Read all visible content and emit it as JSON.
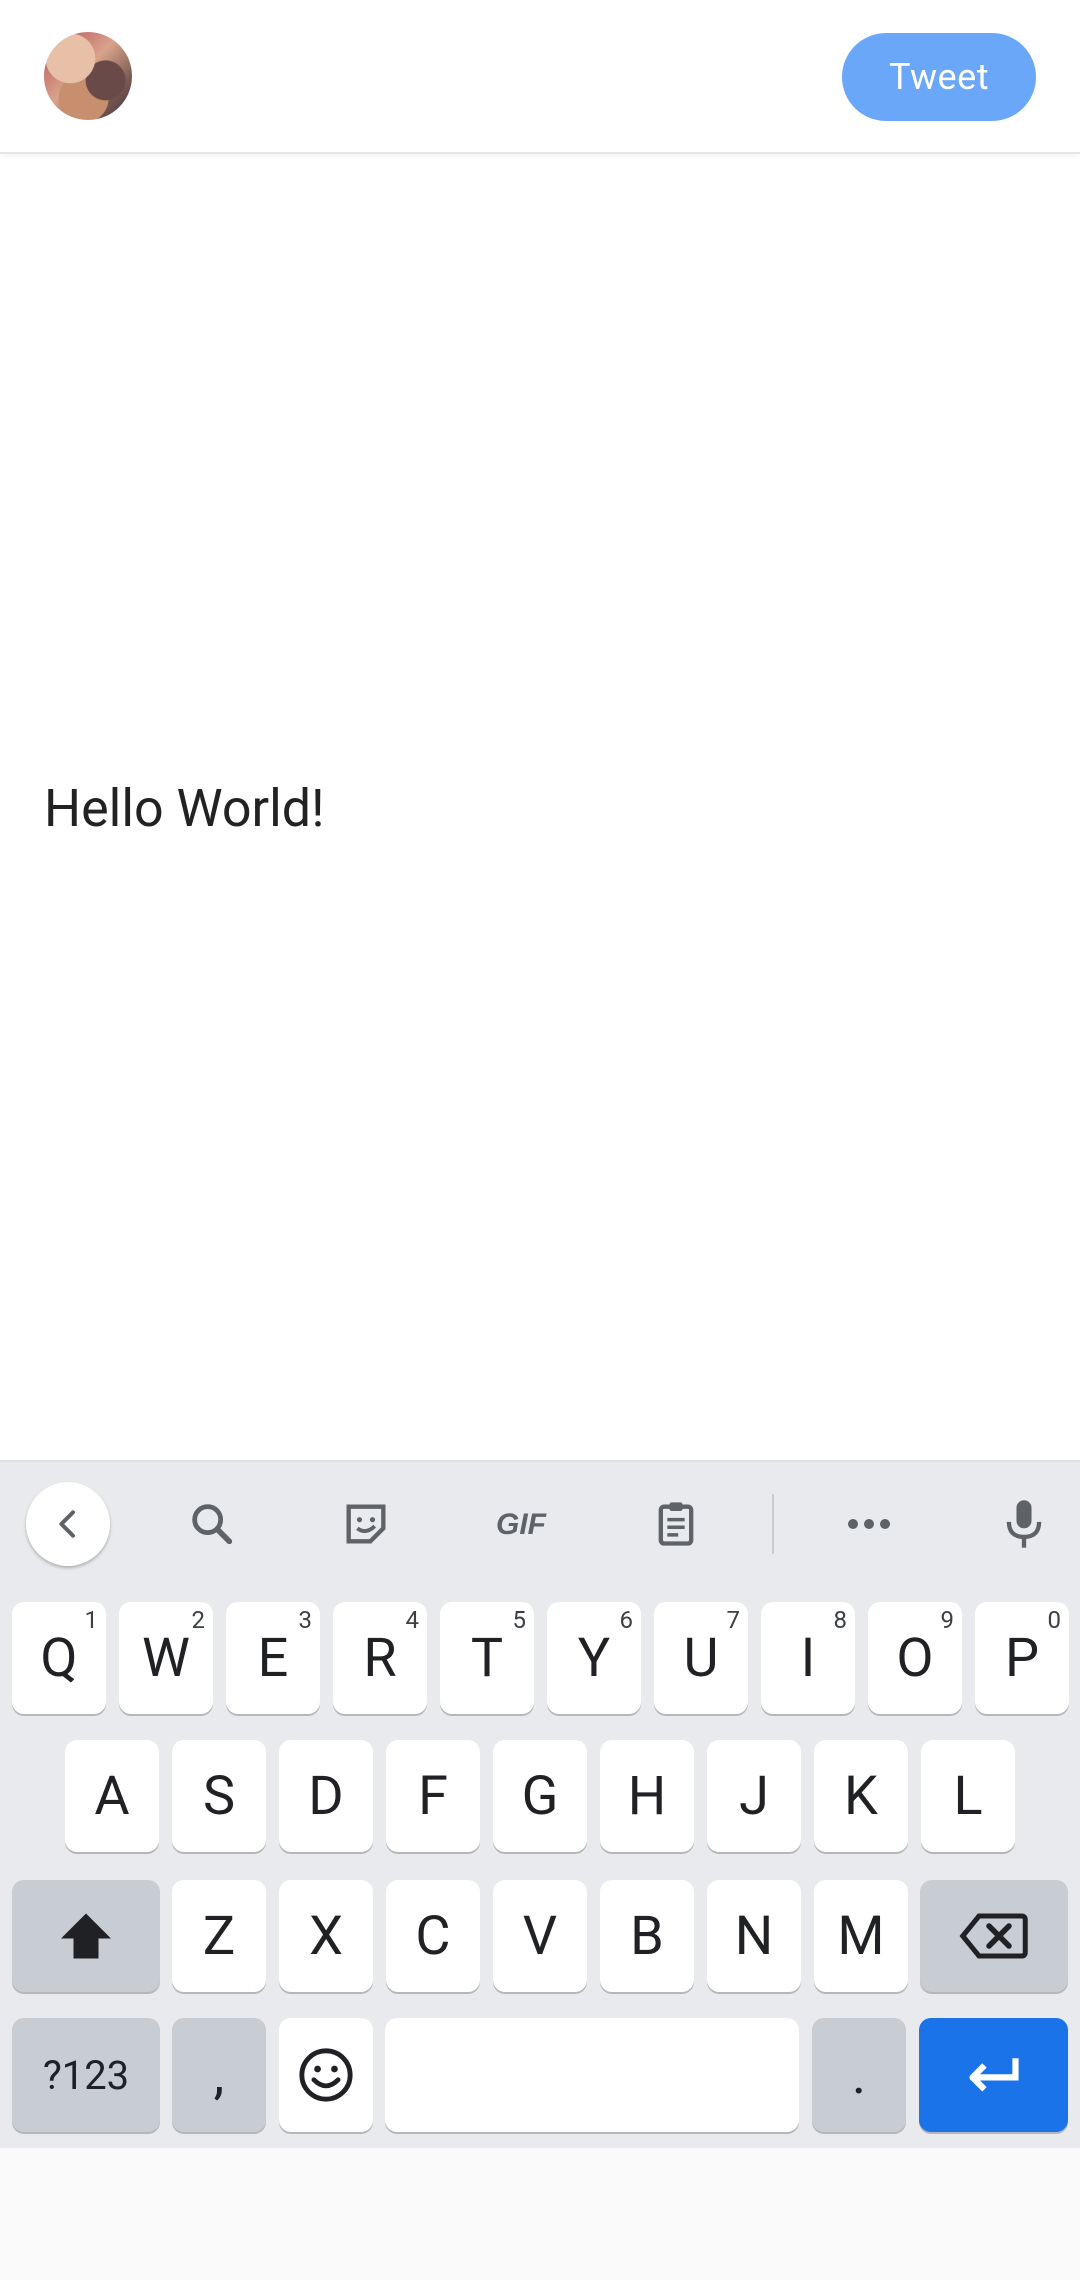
{
  "header": {
    "tweet_label": "Tweet"
  },
  "compose": {
    "text": "Hello World!"
  },
  "keyboard": {
    "row1": [
      {
        "key": "Q",
        "hint": "1"
      },
      {
        "key": "W",
        "hint": "2"
      },
      {
        "key": "E",
        "hint": "3"
      },
      {
        "key": "R",
        "hint": "4"
      },
      {
        "key": "T",
        "hint": "5"
      },
      {
        "key": "Y",
        "hint": "6"
      },
      {
        "key": "U",
        "hint": "7"
      },
      {
        "key": "I",
        "hint": "8"
      },
      {
        "key": "O",
        "hint": "9"
      },
      {
        "key": "P",
        "hint": "0"
      }
    ],
    "row2": [
      "A",
      "S",
      "D",
      "F",
      "G",
      "H",
      "J",
      "K",
      "L"
    ],
    "row3": [
      "Z",
      "X",
      "C",
      "V",
      "B",
      "N",
      "M"
    ],
    "symbols_label": "?123",
    "comma_label": ",",
    "period_label": "."
  },
  "icons": {
    "back": "chevron-left-icon",
    "search": "search-icon",
    "sticker": "sticker-icon",
    "gif": "gif-icon",
    "clipboard": "clipboard-icon",
    "more": "more-icon",
    "mic": "mic-icon",
    "shift": "shift-icon",
    "backspace": "backspace-icon",
    "emoji": "emoji-icon",
    "enter": "enter-icon"
  },
  "colors": {
    "tweet_button": "#6aa7f8",
    "enter_key": "#1a73e8",
    "keyboard_bg": "#e8eaed"
  }
}
